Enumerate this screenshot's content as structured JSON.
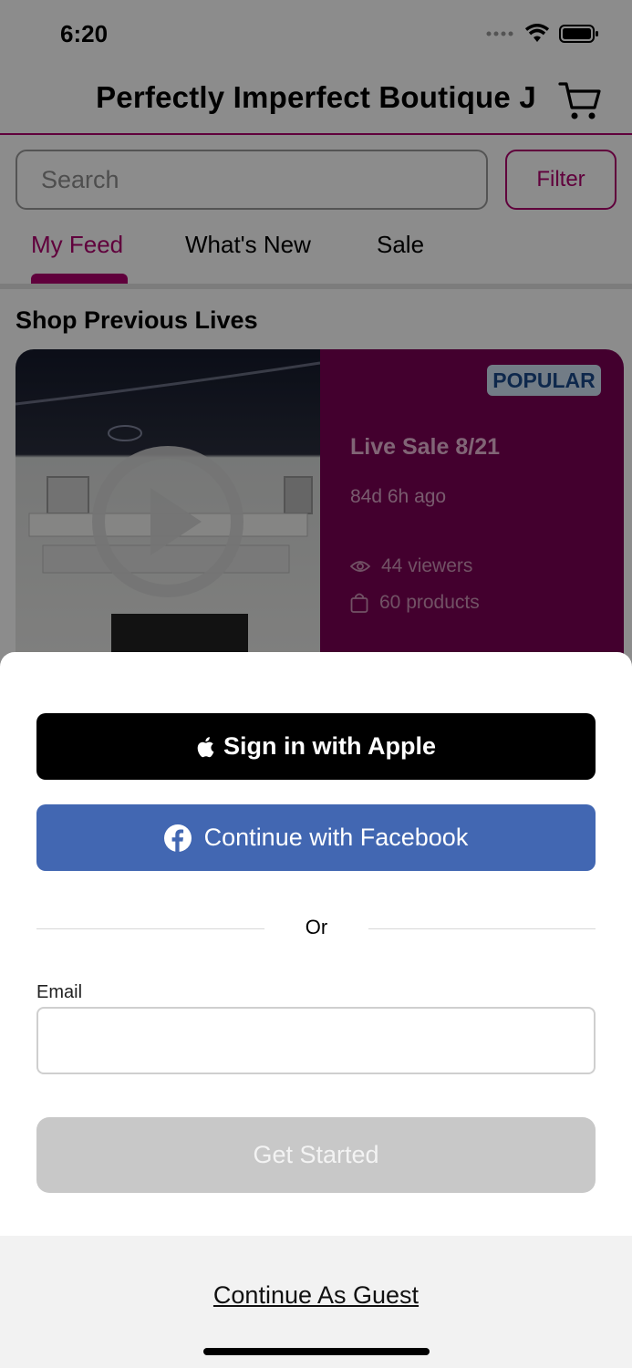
{
  "status_bar": {
    "time": "6:20"
  },
  "header": {
    "title": "Perfectly Imperfect Boutique J",
    "cart_icon": "cart-icon"
  },
  "search": {
    "placeholder": "Search",
    "filter_label": "Filter"
  },
  "tabs": [
    {
      "label": "My Feed",
      "active": true
    },
    {
      "label": "What's New",
      "active": false
    },
    {
      "label": "Sale",
      "active": false
    }
  ],
  "section": {
    "title": "Shop Previous Lives"
  },
  "live_card": {
    "badge": "POPULAR",
    "title": "Live Sale 8/21",
    "ago": "84d 6h ago",
    "viewers": "44 viewers",
    "products": "60 products"
  },
  "sheet": {
    "apple_label": "Sign in with Apple",
    "facebook_label": "Continue with Facebook",
    "or_label": "Or",
    "email_label": "Email",
    "email_value": "",
    "get_started_label": "Get Started",
    "guest_label": "Continue As Guest"
  },
  "colors": {
    "brand": "#b0006e",
    "card_info_bg": "#7a0055",
    "facebook_blue": "#4267b2",
    "disabled_button": "#c8c8c8"
  }
}
